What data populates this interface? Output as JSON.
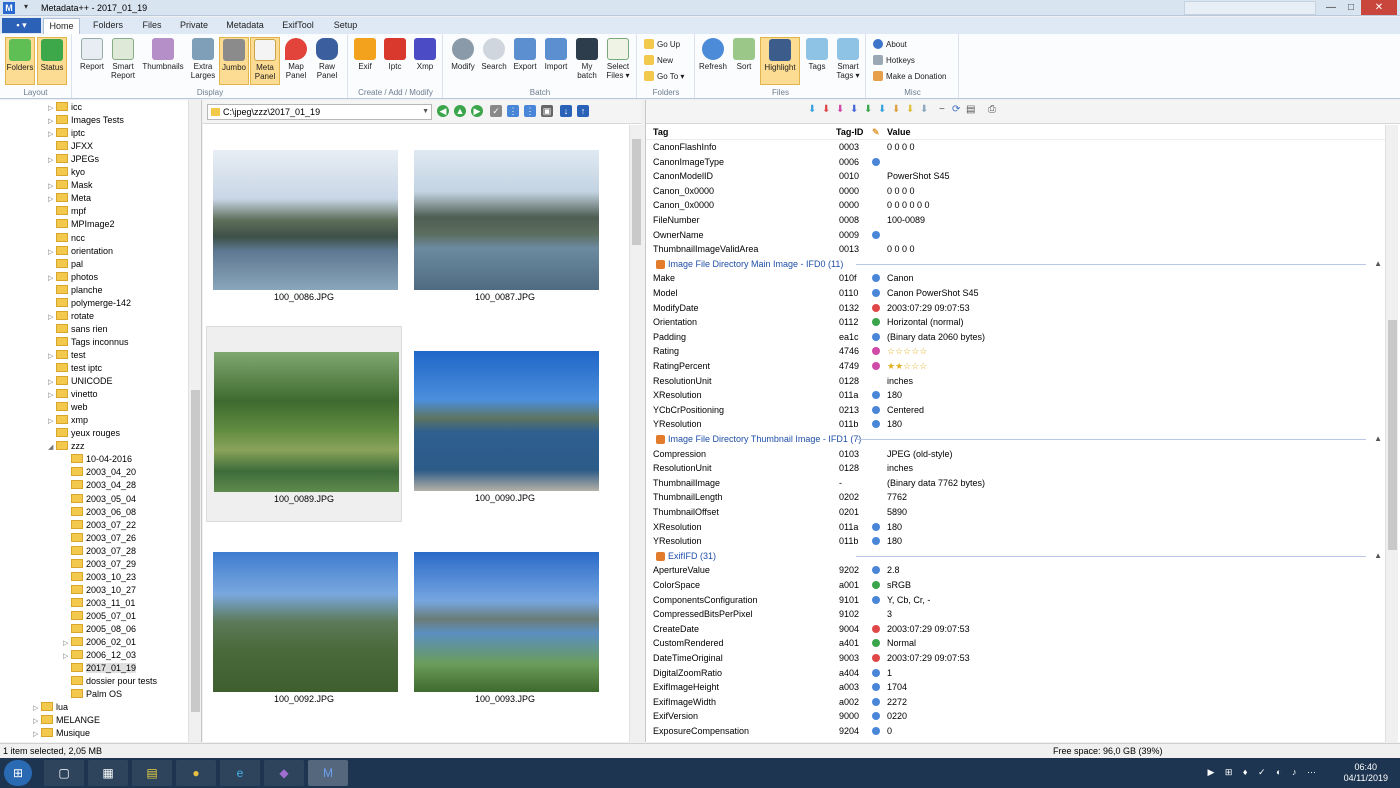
{
  "window": {
    "title": "Metadata++ - 2017_01_19",
    "qa": "▾",
    "minimize": "—",
    "maximize": "□",
    "close": "✕"
  },
  "appmenu": {
    "label": "▪ ▾"
  },
  "tabs": [
    {
      "label": "Home",
      "active": true
    },
    {
      "label": "Folders"
    },
    {
      "label": "Files"
    },
    {
      "label": "Private"
    },
    {
      "label": "Metadata"
    },
    {
      "label": "ExifTool"
    },
    {
      "label": "Setup"
    }
  ],
  "ribbon": {
    "groups": {
      "layout": "Layout",
      "display": "Display",
      "create": "Create / Add / Modify",
      "batch": "Batch",
      "folders": "Folders",
      "files": "Files",
      "misc": "Misc"
    },
    "buttons": {
      "folders": "Folders",
      "status": "Status",
      "report": "Report",
      "smart_report_1": "Smart",
      "smart_report_2": "Report",
      "thumbnails": "Thumbnails",
      "extra_larges_1": "Extra",
      "extra_larges_2": "Larges",
      "jumbo": "Jumbo",
      "meta_panel_1": "Meta",
      "meta_panel_2": "Panel",
      "map_panel_1": "Map",
      "map_panel_2": "Panel",
      "raw_panel_1": "Raw",
      "raw_panel_2": "Panel",
      "exif": "Exif",
      "iptc": "Iptc",
      "xmp": "Xmp",
      "modify": "Modify",
      "search": "Search",
      "export": "Export",
      "import": "Import",
      "my_batch_1": "My",
      "my_batch_2": "batch",
      "select_files_1": "Select",
      "select_files_2": "Files ▾",
      "go_up": "Go Up",
      "new": "New",
      "go_to": "Go To ▾",
      "refresh": "Refresh",
      "sort": "Sort",
      "highlight": "Highlight",
      "tags": "Tags",
      "smart_tags_1": "Smart",
      "smart_tags_2": "Tags ▾",
      "about": "About",
      "hotkeys": "Hotkeys",
      "donation": "Make a Donation"
    }
  },
  "tree": [
    {
      "label": "icc",
      "depth": 1,
      "exp": "▷"
    },
    {
      "label": "Images Tests",
      "depth": 1,
      "exp": "▷"
    },
    {
      "label": "iptc",
      "depth": 1,
      "exp": "▷"
    },
    {
      "label": "JFXX",
      "depth": 1,
      "exp": ""
    },
    {
      "label": "JPEGs",
      "depth": 1,
      "exp": "▷"
    },
    {
      "label": "kyo",
      "depth": 1,
      "exp": ""
    },
    {
      "label": "Mask",
      "depth": 1,
      "exp": "▷"
    },
    {
      "label": "Meta",
      "depth": 1,
      "exp": "▷"
    },
    {
      "label": "mpf",
      "depth": 1,
      "exp": ""
    },
    {
      "label": "MPImage2",
      "depth": 1,
      "exp": ""
    },
    {
      "label": "ncc",
      "depth": 1,
      "exp": ""
    },
    {
      "label": "orientation",
      "depth": 1,
      "exp": "▷"
    },
    {
      "label": "pal",
      "depth": 1,
      "exp": ""
    },
    {
      "label": "photos",
      "depth": 1,
      "exp": "▷"
    },
    {
      "label": "planche",
      "depth": 1,
      "exp": ""
    },
    {
      "label": "polymerge-142",
      "depth": 1,
      "exp": ""
    },
    {
      "label": "rotate",
      "depth": 1,
      "exp": "▷"
    },
    {
      "label": "sans rien",
      "depth": 1,
      "exp": ""
    },
    {
      "label": "Tags inconnus",
      "depth": 1,
      "exp": ""
    },
    {
      "label": "test",
      "depth": 1,
      "exp": "▷"
    },
    {
      "label": "test iptc",
      "depth": 1,
      "exp": ""
    },
    {
      "label": "UNICODE",
      "depth": 1,
      "exp": "▷"
    },
    {
      "label": "vinetto",
      "depth": 1,
      "exp": "▷"
    },
    {
      "label": "web",
      "depth": 1,
      "exp": ""
    },
    {
      "label": "xmp",
      "depth": 1,
      "exp": "▷"
    },
    {
      "label": "yeux rouges",
      "depth": 1,
      "exp": ""
    },
    {
      "label": "zzz",
      "depth": 1,
      "exp": "◢"
    },
    {
      "label": "10-04-2016",
      "depth": 2,
      "exp": ""
    },
    {
      "label": "2003_04_20",
      "depth": 2,
      "exp": ""
    },
    {
      "label": "2003_04_28",
      "depth": 2,
      "exp": ""
    },
    {
      "label": "2003_05_04",
      "depth": 2,
      "exp": ""
    },
    {
      "label": "2003_06_08",
      "depth": 2,
      "exp": ""
    },
    {
      "label": "2003_07_22",
      "depth": 2,
      "exp": ""
    },
    {
      "label": "2003_07_26",
      "depth": 2,
      "exp": ""
    },
    {
      "label": "2003_07_28",
      "depth": 2,
      "exp": ""
    },
    {
      "label": "2003_07_29",
      "depth": 2,
      "exp": ""
    },
    {
      "label": "2003_10_23",
      "depth": 2,
      "exp": ""
    },
    {
      "label": "2003_10_27",
      "depth": 2,
      "exp": ""
    },
    {
      "label": "2003_11_01",
      "depth": 2,
      "exp": ""
    },
    {
      "label": "2005_07_01",
      "depth": 2,
      "exp": ""
    },
    {
      "label": "2005_08_06",
      "depth": 2,
      "exp": ""
    },
    {
      "label": "2006_02_01",
      "depth": 2,
      "exp": "▷"
    },
    {
      "label": "2006_12_03",
      "depth": 2,
      "exp": "▷"
    },
    {
      "label": "2017_01_19",
      "depth": 2,
      "exp": "",
      "selected": true
    },
    {
      "label": "dossier pour tests",
      "depth": 2,
      "exp": ""
    },
    {
      "label": "Palm OS",
      "depth": 2,
      "exp": ""
    },
    {
      "label": "lua",
      "depth": 0,
      "exp": "▷"
    },
    {
      "label": "MELANGE",
      "depth": 0,
      "exp": "▷"
    },
    {
      "label": "Musique",
      "depth": 0,
      "exp": "▷"
    }
  ],
  "path": {
    "value": "C:\\jpeg\\zzz\\2017_01_19"
  },
  "thumbnails": [
    {
      "name": "100_0086.JPG",
      "kind": "lake-town"
    },
    {
      "name": "100_0087.JPG",
      "kind": "lake-mountain"
    },
    {
      "name": "100_0089.JPG",
      "kind": "garden",
      "selected": true
    },
    {
      "name": "100_0090.JPG",
      "kind": "lake-blue"
    },
    {
      "name": "100_0092.JPG",
      "kind": "gazebo"
    },
    {
      "name": "100_0093.JPG",
      "kind": "lake-view"
    }
  ],
  "metadata": {
    "headers": {
      "tag": "Tag",
      "tagid": "Tag-ID",
      "value": "Value"
    },
    "rows": [
      {
        "tag": "CanonFlashInfo",
        "id": "0003",
        "val": "0 0 0 0",
        "st": ""
      },
      {
        "tag": "CanonImageType",
        "id": "0006",
        "val": "",
        "st": "b"
      },
      {
        "tag": "CanonModelID",
        "id": "0010",
        "val": "PowerShot S45",
        "st": ""
      },
      {
        "tag": "Canon_0x0000",
        "id": "0000",
        "val": "0 0 0 0",
        "st": ""
      },
      {
        "tag": "Canon_0x0000",
        "id": "0000",
        "val": "0 0 0 0 0 0",
        "st": ""
      },
      {
        "tag": "FileNumber",
        "id": "0008",
        "val": "100-0089",
        "st": ""
      },
      {
        "tag": "OwnerName",
        "id": "0009",
        "val": "",
        "st": "b"
      },
      {
        "tag": "ThumbnailImageValidArea",
        "id": "0013",
        "val": "0 0 0 0",
        "st": ""
      },
      {
        "group": "Image File Directory Main Image - IFD0  (11)"
      },
      {
        "tag": "Make",
        "id": "010f",
        "val": "Canon",
        "st": "b"
      },
      {
        "tag": "Model",
        "id": "0110",
        "val": "Canon PowerShot S45",
        "st": "b"
      },
      {
        "tag": "ModifyDate",
        "id": "0132",
        "val": "2003:07:29 09:07:53",
        "st": "r"
      },
      {
        "tag": "Orientation",
        "id": "0112",
        "val": "Horizontal (normal)",
        "st": "g"
      },
      {
        "tag": "Padding",
        "id": "ea1c",
        "val": "(Binary data 2060 bytes)",
        "st": "b"
      },
      {
        "tag": "Rating",
        "id": "4746",
        "val": "☆☆☆☆☆",
        "st": "p"
      },
      {
        "tag": "RatingPercent",
        "id": "4749",
        "val": "★★☆☆☆",
        "st": "p"
      },
      {
        "tag": "ResolutionUnit",
        "id": "0128",
        "val": "inches",
        "st": ""
      },
      {
        "tag": "XResolution",
        "id": "011a",
        "val": "180",
        "st": "b"
      },
      {
        "tag": "YCbCrPositioning",
        "id": "0213",
        "val": "Centered",
        "st": "b"
      },
      {
        "tag": "YResolution",
        "id": "011b",
        "val": "180",
        "st": "b"
      },
      {
        "group": "Image File Directory Thumbnail Image - IFD1  (7)"
      },
      {
        "tag": "Compression",
        "id": "0103",
        "val": "JPEG (old-style)",
        "st": ""
      },
      {
        "tag": "ResolutionUnit",
        "id": "0128",
        "val": "inches",
        "st": ""
      },
      {
        "tag": "ThumbnailImage",
        "id": "-",
        "val": "(Binary data 7762 bytes)",
        "st": ""
      },
      {
        "tag": "ThumbnailLength",
        "id": "0202",
        "val": "7762",
        "st": ""
      },
      {
        "tag": "ThumbnailOffset",
        "id": "0201",
        "val": "5890",
        "st": ""
      },
      {
        "tag": "XResolution",
        "id": "011a",
        "val": "180",
        "st": "b"
      },
      {
        "tag": "YResolution",
        "id": "011b",
        "val": "180",
        "st": "b"
      },
      {
        "group": "ExifIFD  (31)"
      },
      {
        "tag": "ApertureValue",
        "id": "9202",
        "val": "2.8",
        "st": "b"
      },
      {
        "tag": "ColorSpace",
        "id": "a001",
        "val": "sRGB",
        "st": "g"
      },
      {
        "tag": "ComponentsConfiguration",
        "id": "9101",
        "val": "Y, Cb, Cr, -",
        "st": "b"
      },
      {
        "tag": "CompressedBitsPerPixel",
        "id": "9102",
        "val": "3",
        "st": ""
      },
      {
        "tag": "CreateDate",
        "id": "9004",
        "val": "2003:07:29 09:07:53",
        "st": "r"
      },
      {
        "tag": "CustomRendered",
        "id": "a401",
        "val": "Normal",
        "st": "g"
      },
      {
        "tag": "DateTimeOriginal",
        "id": "9003",
        "val": "2003:07:29 09:07:53",
        "st": "r"
      },
      {
        "tag": "DigitalZoomRatio",
        "id": "a404",
        "val": "1",
        "st": "b"
      },
      {
        "tag": "ExifImageHeight",
        "id": "a003",
        "val": "1704",
        "st": "b"
      },
      {
        "tag": "ExifImageWidth",
        "id": "a002",
        "val": "2272",
        "st": "b"
      },
      {
        "tag": "ExifVersion",
        "id": "9000",
        "val": "0220",
        "st": "b"
      },
      {
        "tag": "ExposureCompensation",
        "id": "9204",
        "val": "0",
        "st": "b"
      }
    ]
  },
  "status": {
    "selection": "1 item selected, 2,05 MB",
    "freespace": "Free space: 96,0 GB  (39%)"
  },
  "taskbar": {
    "time": "06:40",
    "date": "04/11/2019",
    "tray": "▶ ⊞ ♦ ✓ ◐ ♪ ⋯"
  },
  "colors": {
    "accent": "#2b62b8",
    "status_blue": "#4a86d8",
    "status_green": "#3aa54a",
    "status_red": "#e04848",
    "status_pink": "#d04aa8"
  }
}
